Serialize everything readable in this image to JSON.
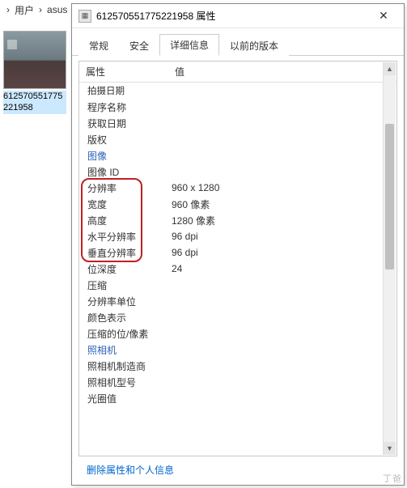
{
  "breadcrumb": {
    "items": [
      "用户",
      "asus"
    ],
    "sep": "›"
  },
  "thumbnail": {
    "label": "612570551775221958"
  },
  "dialog": {
    "icon_glyph": "▦",
    "title": "612570551775221958 属性",
    "close_glyph": "✕"
  },
  "tabs": {
    "items": [
      {
        "label": "常规",
        "active": false
      },
      {
        "label": "安全",
        "active": false
      },
      {
        "label": "详细信息",
        "active": true
      },
      {
        "label": "以前的版本",
        "active": false
      }
    ]
  },
  "details_header": {
    "prop": "属性",
    "val": "值"
  },
  "rows": [
    {
      "kind": "subhdr",
      "prop": "拍摄日期",
      "val": ""
    },
    {
      "kind": "norm",
      "prop": "程序名称",
      "val": ""
    },
    {
      "kind": "norm",
      "prop": "获取日期",
      "val": ""
    },
    {
      "kind": "norm",
      "prop": "版权",
      "val": ""
    },
    {
      "kind": "section",
      "prop": "图像",
      "val": ""
    },
    {
      "kind": "norm",
      "prop": "图像 ID",
      "val": ""
    },
    {
      "kind": "norm",
      "prop": "分辨率",
      "val": "960 x 1280"
    },
    {
      "kind": "norm",
      "prop": "宽度",
      "val": "960 像素"
    },
    {
      "kind": "norm",
      "prop": "高度",
      "val": "1280 像素"
    },
    {
      "kind": "norm",
      "prop": "水平分辨率",
      "val": "96 dpi"
    },
    {
      "kind": "norm",
      "prop": "垂直分辨率",
      "val": "96 dpi"
    },
    {
      "kind": "norm",
      "prop": "位深度",
      "val": "24"
    },
    {
      "kind": "norm",
      "prop": "压缩",
      "val": ""
    },
    {
      "kind": "norm",
      "prop": "分辨率单位",
      "val": ""
    },
    {
      "kind": "norm",
      "prop": "颜色表示",
      "val": ""
    },
    {
      "kind": "norm",
      "prop": "压缩的位/像素",
      "val": ""
    },
    {
      "kind": "section",
      "prop": "照相机",
      "val": ""
    },
    {
      "kind": "norm",
      "prop": "照相机制造商",
      "val": ""
    },
    {
      "kind": "norm",
      "prop": "照相机型号",
      "val": ""
    },
    {
      "kind": "norm",
      "prop": "光圈值",
      "val": ""
    }
  ],
  "footer": {
    "link": "删除属性和个人信息"
  },
  "scrollbar": {
    "up": "▲",
    "down": "▼"
  },
  "watermark": "丁爸"
}
